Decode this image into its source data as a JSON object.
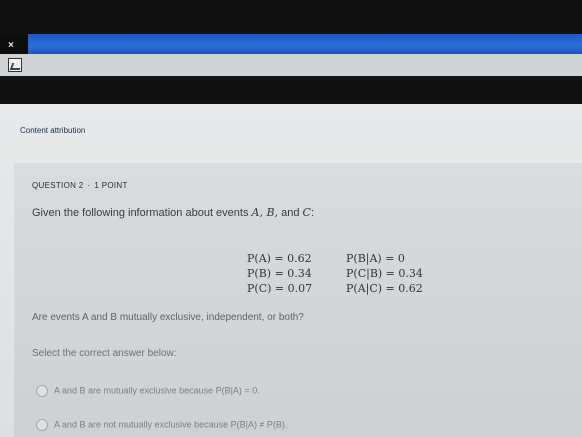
{
  "window": {
    "close_label": "×"
  },
  "content_attribution": "Content attribution",
  "question": {
    "number_label": "QUESTION 2",
    "separator": "·",
    "points_label": "1 POINT",
    "intro_prefix": "Given the following information about events ",
    "intro_events": "A, B,",
    "intro_and": " and ",
    "intro_last": "C",
    "intro_suffix": ":",
    "given_left": [
      "P(A) = 0.62",
      "P(B) = 0.34",
      "P(C) = 0.07"
    ],
    "given_right": [
      "P(B|A) = 0",
      "P(C|B) = 0.34",
      "P(A|C) = 0.62"
    ],
    "question_text": "Are events A and B mutually exclusive, independent, or both?",
    "select_prompt": "Select the correct answer below:",
    "options": [
      "A and B are mutually exclusive because P(B|A) = 0.",
      "A and B are not mutually exclusive because P(B|A) ≠ P(B)."
    ]
  }
}
